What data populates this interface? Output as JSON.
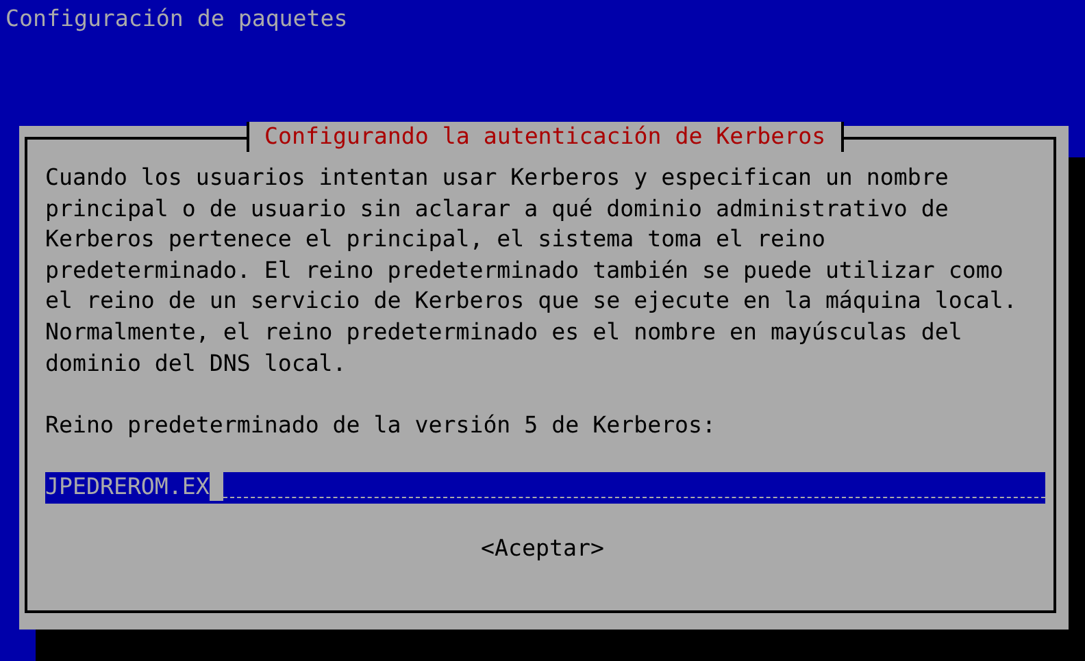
{
  "window": {
    "title": "Configuración de paquetes"
  },
  "dialog": {
    "title": "Configurando la autenticación de Kerberos",
    "message": "Cuando los usuarios intentan usar Kerberos y especifican un nombre\nprincipal o de usuario sin aclarar a qué dominio administrativo de\nKerberos pertenece el principal, el sistema toma el reino\npredeterminado. El reino predeterminado también se puede utilizar como\nel reino de un servicio de Kerberos que se ejecute en la máquina local.\nNormalmente, el reino predeterminado es el nombre en mayúsculas del\ndominio del DNS local.",
    "prompt": "Reino predeterminado de la versión 5 de Kerberos:",
    "field": {
      "value": "JPEDREROM.EX"
    },
    "buttons": [
      "<Aceptar>"
    ]
  }
}
